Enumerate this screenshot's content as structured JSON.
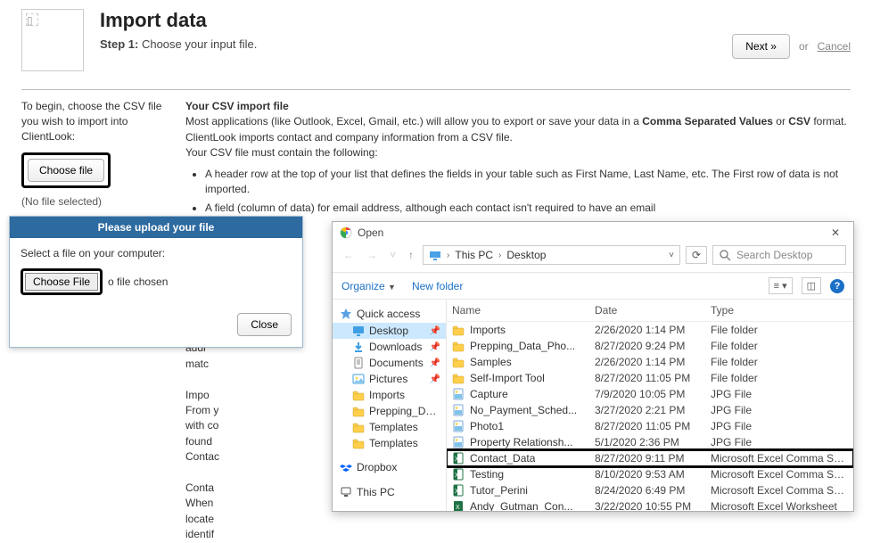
{
  "header": {
    "title": "Import data",
    "step_label": "Step 1:",
    "step_text": " Choose your input file.",
    "next_button": "Next »",
    "or_text": "or",
    "cancel_text": "Cancel"
  },
  "sidebar": {
    "intro": "To begin, choose the CSV file you wish to import into ClientLook:",
    "choose_button": "Choose file",
    "no_file": "(No file selected)"
  },
  "content": {
    "csv_heading": "Your CSV import file",
    "csv_body1": "Most applications (like Outlook, Excel, Gmail, etc.) will allow you to export or save your data in a ",
    "csv_bold1": "Comma Separated Values",
    "csv_body2": " or ",
    "csv_bold2": "CSV",
    "csv_body3": " format. ClientLook imports contact and company information from a CSV file.",
    "csv_must": "Your CSV file must contain the following:",
    "req1": "A header row at the top of your list that defines the fields in your table such as First Name, Last Name, etc. The First row of data is not imported.",
    "req2": "A field (column of data) for email address, although each contact isn't required to have an email",
    "truncated_left": "our C\nepar\nur C\n\n  A\netc. T\n  A\naddr\nmatc\n\nImpo\nFrom y\nwith co\nfound\nContac\n\nConta\nWhen\nlocate\nidentif"
  },
  "upload_dialog": {
    "title": "Please upload your file",
    "prompt": "Select a file on your computer:",
    "choose_button": "Choose File",
    "no_file_chosen": "o file chosen",
    "close_button": "Close"
  },
  "open_dialog": {
    "title": "Open",
    "breadcrumb": {
      "root": "This PC",
      "loc": "Desktop"
    },
    "search_placeholder": "Search Desktop",
    "organize": "Organize",
    "new_folder": "New folder",
    "columns": {
      "name": "Name",
      "date": "Date",
      "type": "Type"
    },
    "side": {
      "quick": "Quick access",
      "desktop": "Desktop",
      "downloads": "Downloads",
      "documents": "Documents",
      "pictures": "Pictures",
      "imports": "Imports",
      "prepping": "Prepping_Data_P…",
      "templates1": "Templates",
      "templates2": "Templates",
      "dropbox": "Dropbox",
      "thispc": "This PC"
    },
    "files": [
      {
        "name": "Imports",
        "date": "2/26/2020 1:14 PM",
        "type": "File folder",
        "kind": "folder"
      },
      {
        "name": "Prepping_Data_Pho...",
        "date": "8/27/2020 9:24 PM",
        "type": "File folder",
        "kind": "folder"
      },
      {
        "name": "Samples",
        "date": "2/26/2020 1:14 PM",
        "type": "File folder",
        "kind": "folder"
      },
      {
        "name": "Self-Import Tool",
        "date": "8/27/2020 11:05 PM",
        "type": "File folder",
        "kind": "folder"
      },
      {
        "name": "Capture",
        "date": "7/9/2020 10:05 PM",
        "type": "JPG File",
        "kind": "jpg"
      },
      {
        "name": "No_Payment_Sched...",
        "date": "3/27/2020 2:21 PM",
        "type": "JPG File",
        "kind": "jpg"
      },
      {
        "name": "Photo1",
        "date": "8/27/2020 11:05 PM",
        "type": "JPG File",
        "kind": "jpg"
      },
      {
        "name": "Property Relationsh...",
        "date": "5/1/2020 2:36 PM",
        "type": "JPG File",
        "kind": "jpg"
      },
      {
        "name": "Contact_Data",
        "date": "8/27/2020 9:11 PM",
        "type": "Microsoft Excel Comma Separated Values",
        "kind": "csv",
        "highlight": true
      },
      {
        "name": "Testing",
        "date": "8/10/2020 9:53 AM",
        "type": "Microsoft Excel Comma Separated Values F",
        "kind": "csv"
      },
      {
        "name": "Tutor_Perini",
        "date": "8/24/2020 6:49 PM",
        "type": "Microsoft Excel Comma Separated Values F",
        "kind": "csv"
      },
      {
        "name": "Andy_Gutman_Con...",
        "date": "3/22/2020 10:55 PM",
        "type": "Microsoft Excel Worksheet",
        "kind": "xlsx"
      }
    ]
  }
}
